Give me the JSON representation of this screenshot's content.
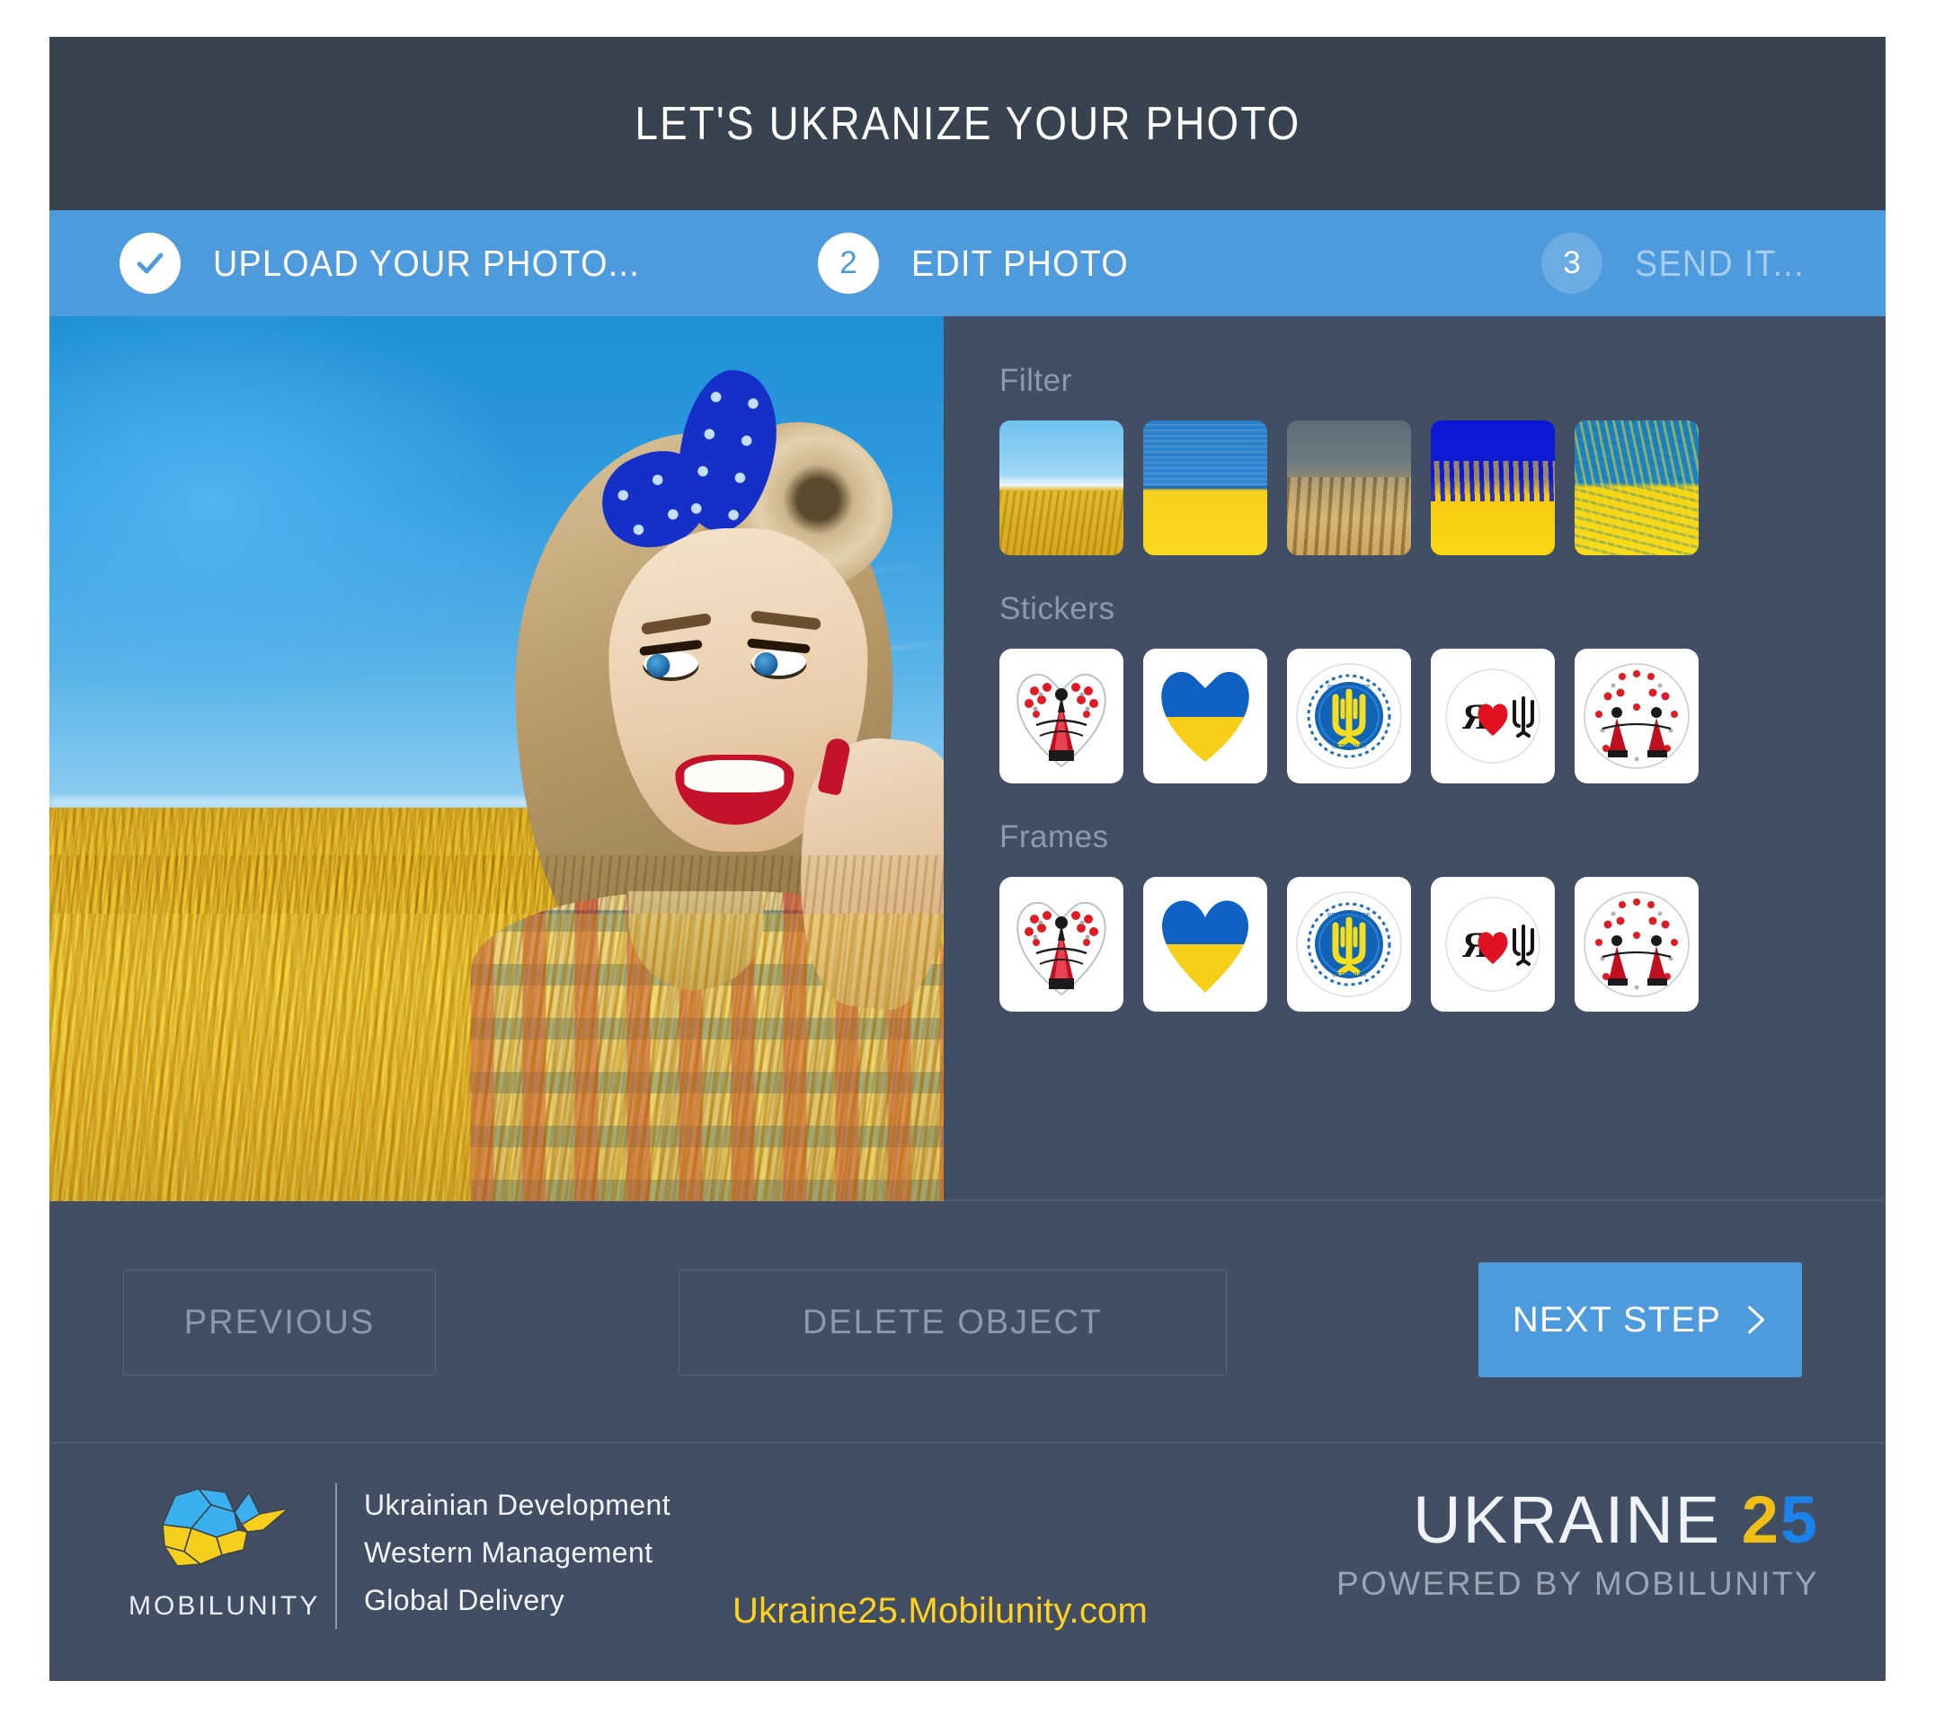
{
  "window": {
    "title": "LET'S UKRANIZE YOUR PHOTO"
  },
  "steps": [
    {
      "badge": "check-icon",
      "label": "UPLOAD YOUR PHOTO...",
      "state": "done"
    },
    {
      "badge": "2",
      "label": "EDIT PHOTO",
      "state": "active"
    },
    {
      "badge": "3",
      "label": "SEND IT...",
      "state": "pending"
    }
  ],
  "tools": {
    "filter": {
      "title": "Filter",
      "items": [
        {
          "name": "filter-wheat-field"
        },
        {
          "name": "filter-flag-flat"
        },
        {
          "name": "filter-wheat-closeup"
        },
        {
          "name": "filter-flag-vivid"
        },
        {
          "name": "filter-flag-grain"
        }
      ]
    },
    "stickers": {
      "title": "Stickers",
      "items": [
        {
          "name": "sticker-embroidery-heart"
        },
        {
          "name": "sticker-flag-heart"
        },
        {
          "name": "sticker-trident-emblem"
        },
        {
          "name": "sticker-ya-love-ua"
        },
        {
          "name": "sticker-embroidery-pair"
        }
      ]
    },
    "frames": {
      "title": "Frames",
      "items": [
        {
          "name": "frame-embroidery-heart"
        },
        {
          "name": "frame-flag-heart"
        },
        {
          "name": "frame-trident-emblem"
        },
        {
          "name": "frame-ya-love-ua"
        },
        {
          "name": "frame-embroidery-pair"
        }
      ]
    }
  },
  "actions": {
    "previous": "PREVIOUS",
    "delete_object": "DELETE OBJECT",
    "next_step": "NEXT STEP"
  },
  "footer": {
    "brand_name": "MOBILUNITY",
    "taglines": [
      "Ukrainian Development",
      "Western Management",
      "Global Delivery"
    ],
    "site_url": "Ukraine25.Mobilunity.com",
    "campaign": {
      "word": "UKRAINE",
      "digit_two": "2",
      "digit_five": "5",
      "subtitle": "POWERED BY MOBILUNITY"
    }
  },
  "colors": {
    "window_bg": "#414e63",
    "titlebar_bg": "#39424f",
    "accent_blue": "#4d9bdd",
    "muted_text": "#8e99aa",
    "url_yellow": "#ffd21f",
    "flag_blue": "#0057b7",
    "flag_yellow": "#ffd700"
  }
}
